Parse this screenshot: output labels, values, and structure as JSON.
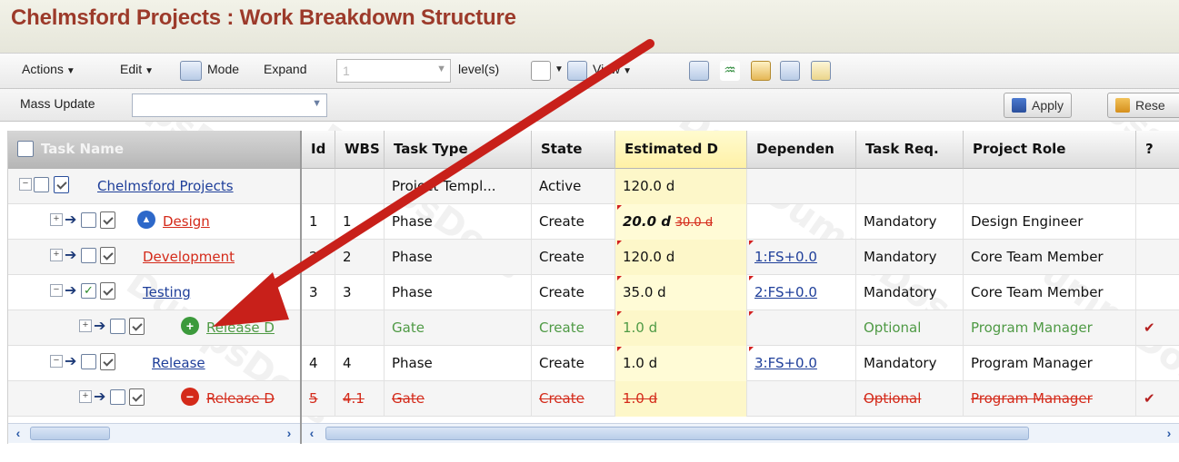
{
  "window": {
    "title": "Chelmsford Projects : Work Breakdown Structure"
  },
  "toolbar": {
    "actions_label": "Actions",
    "edit_label": "Edit",
    "mode_label": "Mode",
    "expand_label": "Expand",
    "expand_value": "1",
    "levels_label": "level(s)",
    "view_label": "View"
  },
  "mass_update": {
    "label": "Mass Update",
    "apply_label": "Apply",
    "reset_label": "Rese"
  },
  "columns": {
    "task_name": "Task Name",
    "id": "Id",
    "wbs": "WBS",
    "task_type": "Task Type",
    "state": "State",
    "estimated": "Estimated D",
    "dependencies": "Dependen",
    "task_req": "Task Req.",
    "project_role": "Project Role",
    "extra": "?"
  },
  "rows": [
    {
      "name": "Chelmsford Projects",
      "id": "",
      "wbs": "",
      "task_type": "Project Templ...",
      "state": "Active",
      "estimated": "120.0 d",
      "estimated_old": "",
      "dependency": "",
      "task_req": "",
      "project_role": "",
      "extra": ""
    },
    {
      "name": "Design",
      "id": "1",
      "wbs": "1",
      "task_type": "Phase",
      "state": "Create",
      "estimated": "20.0 d",
      "estimated_old": "30.0 d",
      "dependency": "",
      "task_req": "Mandatory",
      "project_role": "Design Engineer",
      "extra": ""
    },
    {
      "name": "Development",
      "id": "2",
      "wbs": "2",
      "task_type": "Phase",
      "state": "Create",
      "estimated": "120.0 d",
      "estimated_old": "",
      "dependency": "1:FS+0.0",
      "task_req": "Mandatory",
      "project_role": "Core Team Member",
      "extra": ""
    },
    {
      "name": "Testing",
      "id": "3",
      "wbs": "3",
      "task_type": "Phase",
      "state": "Create",
      "estimated": "35.0 d",
      "estimated_old": "",
      "dependency": "2:FS+0.0",
      "task_req": "Mandatory",
      "project_role": "Core Team Member",
      "extra": ""
    },
    {
      "name": "Release D",
      "id": "",
      "wbs": "",
      "task_type": "Gate",
      "state": "Create",
      "estimated": "1.0 d",
      "estimated_old": "",
      "dependency": "",
      "task_req": "Optional",
      "project_role": "Program Manager",
      "extra": "✔"
    },
    {
      "name": "Release",
      "id": "4",
      "wbs": "4",
      "task_type": "Phase",
      "state": "Create",
      "estimated": "1.0 d",
      "estimated_old": "",
      "dependency": "3:FS+0.0",
      "task_req": "Mandatory",
      "project_role": "Program Manager",
      "extra": ""
    },
    {
      "name": "Release D",
      "id": "5",
      "wbs": "4.1",
      "task_type": "Gate",
      "state": "Create",
      "estimated": "1.0 d",
      "estimated_old": "",
      "dependency": "",
      "task_req": "Optional",
      "project_role": "Program Manager",
      "extra": "✔"
    }
  ],
  "colors": {
    "title": "#9c3a2a",
    "link": "#1f3f9a",
    "added_green": "#4f9a45",
    "deleted_red": "#d42a1a",
    "arrow_red": "#c8201a",
    "estimate_highlight": "#fffbd6"
  }
}
